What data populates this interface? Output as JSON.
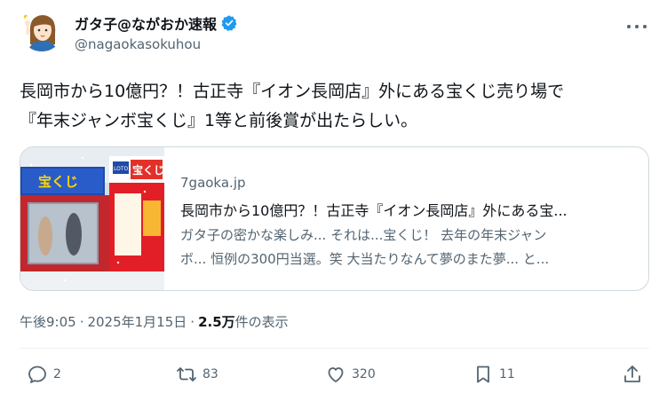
{
  "author": {
    "display_name": "ガタ子@ながおか速報",
    "handle": "@nagaokasokuhou",
    "verified": true,
    "avatar_icon": "avatar-illustration"
  },
  "tweet": {
    "text_line1": "長岡市から10億円？！古正寺『イオン長岡店』外にある宝くじ売り場で",
    "text_line2": "『年末ジャンボ宝くじ』1等と前後賞が出たらしい。"
  },
  "card": {
    "image_icon": "lottery-booth-photo",
    "image_sign_left": "宝くじ",
    "image_sign_right": "宝くじ",
    "image_sign_logo": "LOTO",
    "domain": "7gaoka.jp",
    "title": "長岡市から10億円？！古正寺『イオン長岡店』外にある宝...",
    "desc_line1": "ガタ子の密かな楽しみ... それは...宝くじ！ 去年の年末ジャン",
    "desc_line2": "ボ... 恒例の300円当選。笑 大当たりなんて夢のまた夢... と..."
  },
  "meta": {
    "time": "午後9:05",
    "separator": "·",
    "date": "2025年1月15日",
    "views_count": "2.5万",
    "views_label": " 件の表示"
  },
  "actions": {
    "reply_count": "2",
    "retweet_count": "83",
    "like_count": "320",
    "bookmark_count": "11"
  },
  "colors": {
    "text": "#0f1419",
    "secondary": "#536471",
    "border": "#cfd9de",
    "verified": "#1d9bf0"
  }
}
